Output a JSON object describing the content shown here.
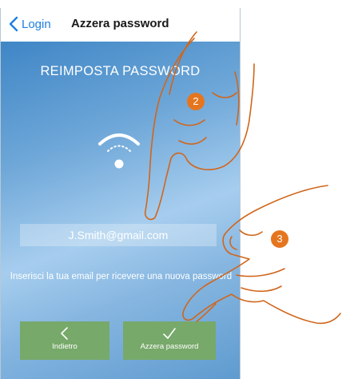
{
  "navbar": {
    "back_label": "Login",
    "title": "Azzera password"
  },
  "screen": {
    "heading": "REIMPOSTA PASSWORD",
    "email_value": "J.Smith@gmail.com",
    "hint": "Inserisci la tua email per ricevere una nuova password"
  },
  "buttons": {
    "back_label": "Indietro",
    "reset_label": "Azzera password"
  },
  "steps": {
    "first": "2",
    "second": "3"
  },
  "colors": {
    "accent": "#1f7fe0",
    "button_green": "#77a96a",
    "badge_orange": "#e5761f"
  },
  "icons": {
    "back": "chevron-left-icon",
    "wifi": "wifi-icon",
    "back_button": "chevron-left-icon",
    "confirm_button": "checkmark-icon"
  }
}
